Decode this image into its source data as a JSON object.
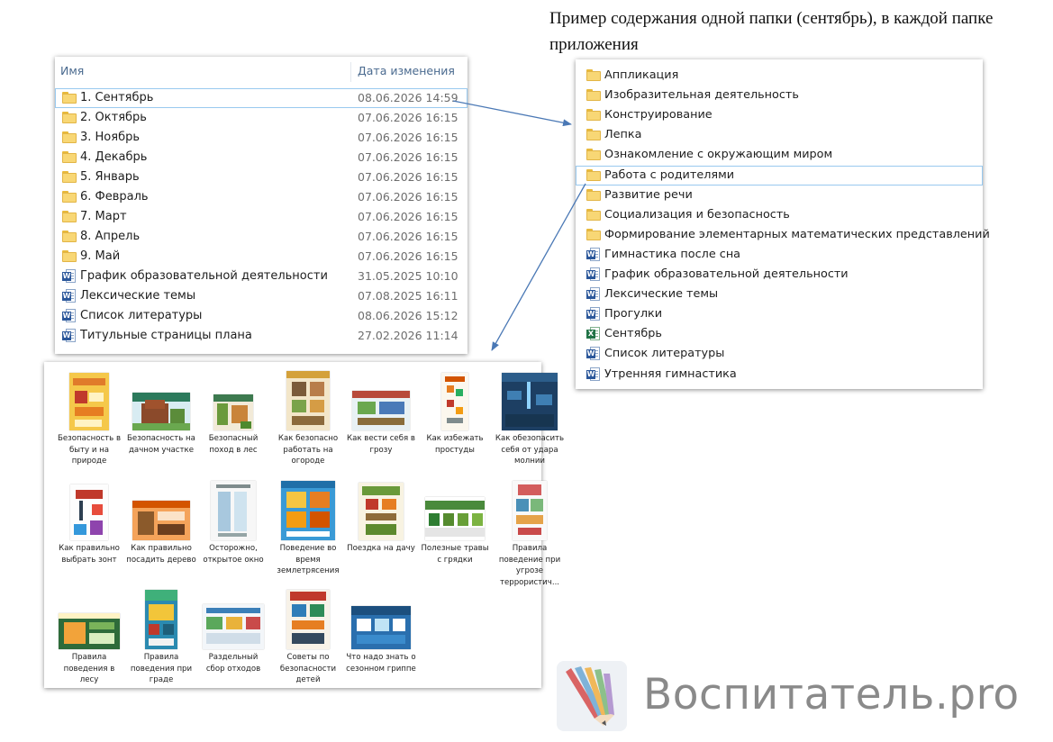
{
  "caption": "Пример содержания одной папки (сентябрь), в каждой папке приложения",
  "explorer": {
    "col_name": "Имя",
    "col_date": "Дата изменения",
    "rows": [
      {
        "name": "1. Сентябрь",
        "date": "08.06.2026 14:59",
        "icon": "folder-icon"
      },
      {
        "name": "2. Октябрь",
        "date": "07.06.2026 16:15",
        "icon": "folder-icon"
      },
      {
        "name": "3. Ноябрь",
        "date": "07.06.2026 16:15",
        "icon": "folder-icon"
      },
      {
        "name": "4. Декабрь",
        "date": "07.06.2026 16:15",
        "icon": "folder-icon"
      },
      {
        "name": "5. Январь",
        "date": "07.06.2026 16:15",
        "icon": "folder-icon"
      },
      {
        "name": "6. Февраль",
        "date": "07.06.2026 16:15",
        "icon": "folder-icon"
      },
      {
        "name": "7. Март",
        "date": "07.06.2026 16:15",
        "icon": "folder-icon"
      },
      {
        "name": "8. Апрель",
        "date": "07.06.2026 16:15",
        "icon": "folder-icon"
      },
      {
        "name": "9. Май",
        "date": "07.06.2026 16:15",
        "icon": "folder-icon"
      },
      {
        "name": "График образовательной деятельности",
        "date": "31.05.2025 10:10",
        "icon": "word-doc-icon"
      },
      {
        "name": "Лексические темы",
        "date": "07.08.2025 16:11",
        "icon": "word-doc-icon"
      },
      {
        "name": "Список литературы",
        "date": "08.06.2026 15:12",
        "icon": "word-doc-icon"
      },
      {
        "name": "Титульные страницы плана",
        "date": "27.02.2026 11:14",
        "icon": "word-doc-icon"
      }
    ]
  },
  "contents": {
    "items": [
      {
        "name": "Аппликация",
        "icon": "folder-icon"
      },
      {
        "name": "Изобразительная деятельность",
        "icon": "folder-icon"
      },
      {
        "name": "Конструирование",
        "icon": "folder-icon"
      },
      {
        "name": "Лепка",
        "icon": "folder-icon"
      },
      {
        "name": "Ознакомление с окружающим миром",
        "icon": "folder-icon"
      },
      {
        "name": "Работа с родителями",
        "icon": "folder-icon"
      },
      {
        "name": "Развитие речи",
        "icon": "folder-icon"
      },
      {
        "name": "Социализация и безопасность",
        "icon": "folder-icon"
      },
      {
        "name": "Формирование элементарных математических представлений",
        "icon": "folder-icon"
      },
      {
        "name": "Гимнастика после сна",
        "icon": "word-doc-icon"
      },
      {
        "name": "График образовательной деятельности",
        "icon": "word-doc-icon"
      },
      {
        "name": "Лексические темы",
        "icon": "word-doc-icon"
      },
      {
        "name": "Прогулки",
        "icon": "word-doc-icon"
      },
      {
        "name": "Сентябрь",
        "icon": "excel-doc-icon"
      },
      {
        "name": "Список литературы",
        "icon": "word-doc-icon"
      },
      {
        "name": "Утренняя гимнастика",
        "icon": "word-doc-icon"
      }
    ]
  },
  "thumbnails": [
    {
      "label": "Безопасность в быту и на природе"
    },
    {
      "label": "Безопасность на дачном участке"
    },
    {
      "label": "Безопасный поход в лес"
    },
    {
      "label": "Как безопасно работать на огороде"
    },
    {
      "label": "Как вести себя в грозу"
    },
    {
      "label": "Как избежать простуды"
    },
    {
      "label": "Как обезопасить себя от удара молнии"
    },
    {
      "label": "Как правильно выбрать зонт"
    },
    {
      "label": "Как правильно посадить дерево"
    },
    {
      "label": "Осторожно, открытое окно"
    },
    {
      "label": "Поведение во время землетрясения"
    },
    {
      "label": "Поездка на дачу"
    },
    {
      "label": "Полезные травы с грядки"
    },
    {
      "label": "Правила поведение при угрозе террористич..."
    },
    {
      "label": "Правила поведения в лесу"
    },
    {
      "label": "Правила поведения при граде"
    },
    {
      "label": "Раздельный сбор отходов"
    },
    {
      "label": "Советы по безопасности детей"
    },
    {
      "label": "Что надо знать о сезонном гриппе"
    }
  ],
  "logo": {
    "text": "Воспитатель.pro"
  },
  "colors": {
    "arrow": "#4a78b5",
    "selection": "#99c9ef",
    "folder": "#f8d775",
    "word": "#2b579a",
    "excel": "#217346"
  }
}
